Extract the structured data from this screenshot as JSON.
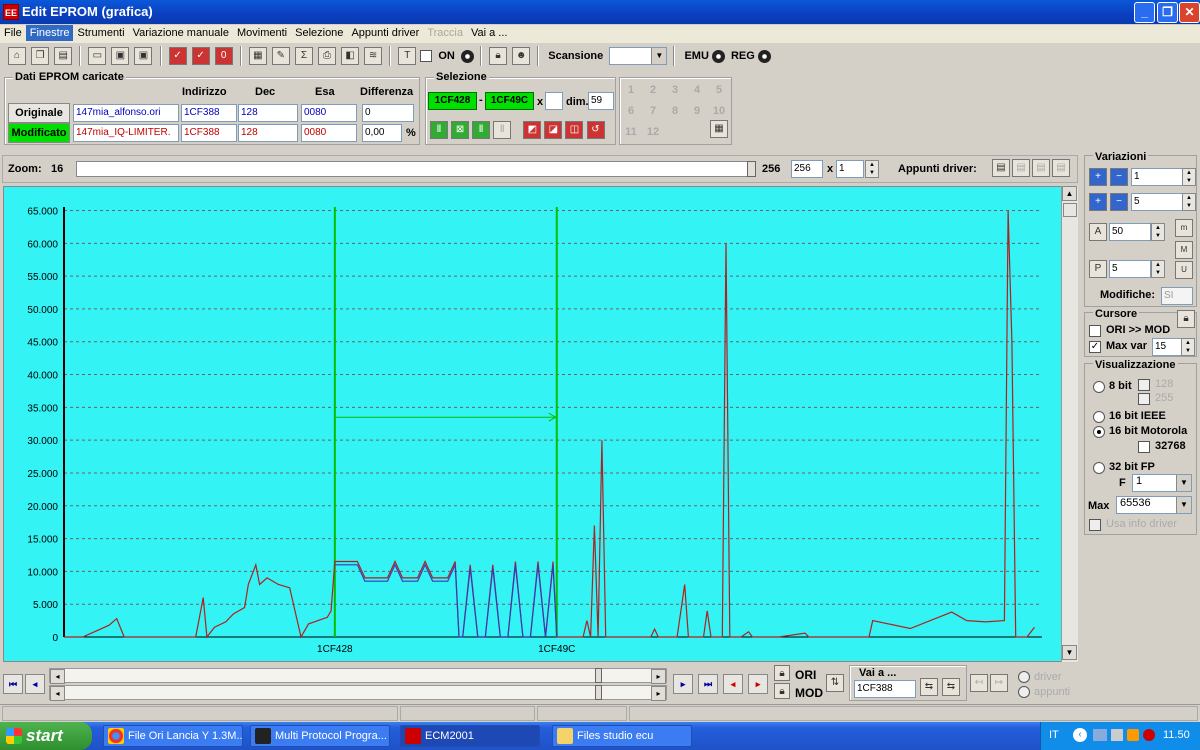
{
  "window": {
    "title": "Edit EPROM (grafica)",
    "icon": "ecm-app-icon",
    "min": "_",
    "max": "❐",
    "close": "✕"
  },
  "menu": [
    {
      "label": "File",
      "state": "normal"
    },
    {
      "label": "Finestre",
      "state": "active"
    },
    {
      "label": "Strumenti",
      "state": "normal"
    },
    {
      "label": "Variazione manuale",
      "state": "normal"
    },
    {
      "label": "Movimenti",
      "state": "normal"
    },
    {
      "label": "Selezione",
      "state": "normal"
    },
    {
      "label": "Appunti driver",
      "state": "normal"
    },
    {
      "label": "Traccia",
      "state": "disabled"
    },
    {
      "label": "Vai a ...",
      "state": "normal"
    }
  ],
  "toolbar": {
    "on_label": "ON",
    "scansione_label": "Scansione",
    "scansione_value": "",
    "emu_label": "EMU",
    "reg_label": "REG"
  },
  "dati": {
    "title": "Dati EPROM caricate",
    "headers": {
      "indirizzo": "Indirizzo",
      "dec": "Dec",
      "esa": "Esa",
      "differenza": "Differenza"
    },
    "originale": {
      "button": "Originale",
      "file": "147mia_alfonso.ori",
      "indirizzo": "1CF388",
      "dec": "128",
      "esa": "0080",
      "diff": "0"
    },
    "modificato": {
      "button": "Modificato",
      "file": "147mia_IQ-LIMITER.",
      "indirizzo": "1CF388",
      "dec": "128",
      "esa": "0080",
      "diff": "0,00",
      "unit": "%"
    }
  },
  "selezione": {
    "title": "Selezione",
    "start": "1CF428",
    "dash": "-",
    "end": "1CF49C",
    "x_label": "x",
    "x_value": "",
    "dim_label": "dim.",
    "dim_value": "59",
    "numbers": [
      "1",
      "2",
      "3",
      "4",
      "5",
      "6",
      "7",
      "8",
      "9",
      "10",
      "11",
      "12"
    ]
  },
  "zoom": {
    "label": "Zoom:",
    "value": "16",
    "max": "256",
    "field": "256",
    "x_label": "x",
    "mult": "1"
  },
  "appunti": {
    "label": "Appunti driver:"
  },
  "chart_data": {
    "type": "line",
    "ylim": [
      0,
      65536
    ],
    "y_ticks": [
      "65.000",
      "60.000",
      "55.000",
      "50.000",
      "45.000",
      "40.000",
      "35.000",
      "30.000",
      "25.000",
      "20.000",
      "15.000",
      "10.000",
      "5.000",
      "0"
    ],
    "y_tick_values": [
      65000,
      60000,
      55000,
      50000,
      45000,
      40000,
      35000,
      30000,
      25000,
      20000,
      15000,
      10000,
      5000,
      0
    ],
    "x_labels": [
      {
        "label": "1CF428",
        "x": 72
      },
      {
        "label": "1CF49C",
        "x": 131
      }
    ],
    "xlim": [
      0,
      260
    ],
    "selection": {
      "start": 72,
      "end": 131,
      "arrow_y": 33500
    },
    "series": [
      {
        "color": "#b02020",
        "points": [
          [
            0,
            0
          ],
          [
            5,
            0
          ],
          [
            12,
            1800
          ],
          [
            14,
            2800
          ],
          [
            16,
            0
          ],
          [
            25,
            0
          ],
          [
            35,
            0
          ],
          [
            37,
            6000
          ],
          [
            38,
            0
          ],
          [
            40,
            1500
          ],
          [
            43,
            2300
          ],
          [
            45,
            3500
          ],
          [
            48,
            4500
          ],
          [
            49,
            8000
          ],
          [
            51,
            11000
          ],
          [
            52,
            8000
          ],
          [
            54,
            9000
          ],
          [
            57,
            8000
          ],
          [
            60,
            7500
          ],
          [
            63,
            0
          ],
          [
            65,
            2000
          ],
          [
            68,
            2600
          ],
          [
            70,
            3000
          ],
          [
            71,
            4000
          ],
          [
            72,
            11500
          ],
          [
            78,
            11500
          ],
          [
            80,
            9000
          ],
          [
            86,
            9000
          ],
          [
            88,
            11500
          ],
          [
            90,
            9000
          ],
          [
            94,
            9000
          ],
          [
            96,
            11500
          ],
          [
            98,
            9000
          ],
          [
            102,
            9000
          ],
          [
            104,
            11500
          ],
          [
            105,
            0
          ],
          [
            106,
            0
          ],
          [
            108,
            11000
          ],
          [
            110,
            0
          ],
          [
            112,
            0
          ],
          [
            114,
            11000
          ],
          [
            116,
            0
          ],
          [
            118,
            0
          ],
          [
            120,
            11500
          ],
          [
            122,
            0
          ],
          [
            124,
            0
          ],
          [
            126,
            11500
          ],
          [
            128,
            0
          ],
          [
            130,
            11500
          ],
          [
            131,
            0
          ],
          [
            138,
            0
          ],
          [
            139,
            2500
          ],
          [
            140,
            0
          ],
          [
            141,
            17000
          ],
          [
            142,
            0
          ],
          [
            143,
            30000
          ],
          [
            144,
            0
          ],
          [
            150,
            0
          ],
          [
            152,
            0
          ],
          [
            156,
            0
          ],
          [
            157,
            1200
          ],
          [
            158,
            0
          ],
          [
            163,
            0
          ],
          [
            165,
            8000
          ],
          [
            166,
            0
          ],
          [
            170,
            0
          ],
          [
            171,
            4000
          ],
          [
            172,
            0
          ],
          [
            175,
            0
          ],
          [
            176,
            60000
          ],
          [
            177,
            0
          ],
          [
            180,
            0
          ],
          [
            182,
            800
          ],
          [
            183,
            0
          ],
          [
            190,
            0
          ],
          [
            197,
            600
          ],
          [
            198,
            0
          ],
          [
            207,
            0
          ],
          [
            210,
            0
          ],
          [
            214,
            0
          ],
          [
            215,
            2500
          ],
          [
            225,
            1300
          ],
          [
            236,
            3800
          ],
          [
            240,
            2500
          ],
          [
            245,
            2300
          ],
          [
            250,
            2500
          ],
          [
            251,
            65000
          ],
          [
            252,
            45000
          ],
          [
            253,
            0
          ],
          [
            256,
            0
          ],
          [
            258,
            1500
          ]
        ]
      },
      {
        "color": "#3a3ab8",
        "points": [
          [
            72,
            11000
          ],
          [
            78,
            11000
          ],
          [
            80,
            8500
          ],
          [
            86,
            8500
          ],
          [
            88,
            11000
          ],
          [
            90,
            8500
          ],
          [
            94,
            8500
          ],
          [
            96,
            11000
          ],
          [
            98,
            8500
          ],
          [
            102,
            8500
          ],
          [
            104,
            11000
          ],
          [
            105,
            0
          ],
          [
            106,
            0
          ],
          [
            108,
            10500
          ],
          [
            110,
            0
          ],
          [
            112,
            0
          ],
          [
            114,
            10500
          ],
          [
            116,
            0
          ],
          [
            118,
            0
          ],
          [
            120,
            11000
          ],
          [
            122,
            0
          ],
          [
            124,
            0
          ],
          [
            126,
            11000
          ],
          [
            128,
            0
          ],
          [
            130,
            11000
          ],
          [
            131,
            0
          ]
        ]
      }
    ]
  },
  "variazioni": {
    "title": "Variazioni",
    "row1_value": "1",
    "row2_value": "5",
    "row3_value": "50",
    "row4_value": "5",
    "modifiche_label": "Modifiche:",
    "modifiche_value": "SI"
  },
  "cursore": {
    "title": "Cursore",
    "ori_mod": "ORI >> MOD",
    "max_var": "Max var",
    "max_var_value": "15"
  },
  "visualizzazione": {
    "title": "Visualizzazione",
    "bit8": "8 bit",
    "v128": "128",
    "v255": "255",
    "ieee": "16 bit IEEE",
    "motorola": "16 bit Motorola",
    "v32768": "32768",
    "fp": "32 bit FP",
    "f_label": "F",
    "f_value": "1",
    "max_label": "Max",
    "max_value": "65536",
    "usa_info": "Usa info driver"
  },
  "bottom": {
    "ori": "ORI",
    "mod": "MOD",
    "vai_a": "Vai a ...",
    "vai_value": "1CF388",
    "driver": "driver",
    "appunti": "appunti"
  },
  "taskbar": {
    "start": "start",
    "tasks": [
      {
        "label": "File Ori Lancia Y 1.3M...",
        "icon": "chrome-icon"
      },
      {
        "label": "Multi Protocol Progra...",
        "icon": "program-icon"
      },
      {
        "label": "ECM2001",
        "icon": "ecm-icon"
      },
      {
        "label": "Files studio ecu",
        "icon": "folder-icon"
      }
    ],
    "lang": "IT",
    "clock": "11.50"
  }
}
